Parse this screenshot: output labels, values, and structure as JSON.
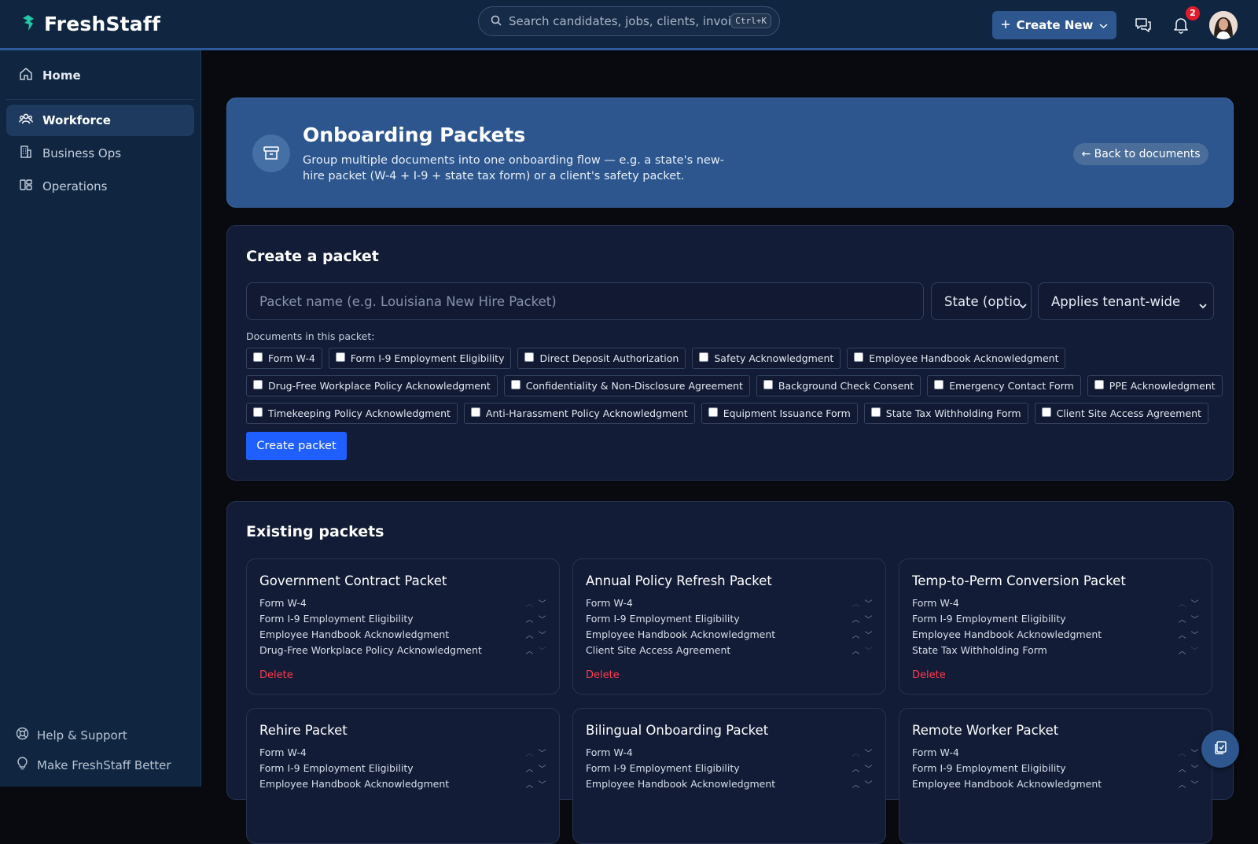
{
  "app": {
    "name": "FreshStaff"
  },
  "search": {
    "placeholder": "Search candidates, jobs, clients, invoices...",
    "shortcut": "Ctrl+K"
  },
  "header": {
    "create_new_label": "Create New",
    "notification_count": "2"
  },
  "sidebar": {
    "items": [
      {
        "label": "Home",
        "icon": "home-icon"
      },
      {
        "label": "Workforce",
        "icon": "users-icon",
        "active": true
      },
      {
        "label": "Business Ops",
        "icon": "building-icon"
      },
      {
        "label": "Operations",
        "icon": "grid-icon"
      }
    ],
    "footer": [
      {
        "label": "Help & Support",
        "icon": "lifebuoy-icon"
      },
      {
        "label": "Make FreshStaff Better",
        "icon": "lightbulb-icon"
      }
    ]
  },
  "hero": {
    "title": "Onboarding Packets",
    "description": "Group multiple documents into one onboarding flow — e.g. a state's new-hire packet (W-4 + I-9 + state tax form) or a client's safety packet.",
    "back_label": "← Back to documents"
  },
  "create": {
    "title": "Create a packet",
    "name_placeholder": "Packet name (e.g. Louisiana New Hire Packet)",
    "state_select": "State (optio",
    "scope_select": "Applies tenant-wide",
    "docs_label": "Documents in this packet:",
    "documents": [
      "Form W-4",
      "Form I-9 Employment Eligibility",
      "Direct Deposit Authorization",
      "Safety Acknowledgment",
      "Employee Handbook Acknowledgment",
      "Drug-Free Workplace Policy Acknowledgment",
      "Confidentiality & Non-Disclosure Agreement",
      "Background Check Consent",
      "Emergency Contact Form",
      "PPE Acknowledgment",
      "Timekeeping Policy Acknowledgment",
      "Anti-Harassment Policy Acknowledgment",
      "Equipment Issuance Form",
      "State Tax Withholding Form",
      "Client Site Access Agreement"
    ],
    "button_label": "Create packet"
  },
  "existing": {
    "title": "Existing packets",
    "delete_label": "Delete",
    "packets": [
      {
        "name": "Government Contract Packet",
        "docs": [
          "Form W-4",
          "Form I-9 Employment Eligibility",
          "Employee Handbook Acknowledgment",
          "Drug-Free Workplace Policy Acknowledgment"
        ]
      },
      {
        "name": "Annual Policy Refresh Packet",
        "docs": [
          "Form W-4",
          "Form I-9 Employment Eligibility",
          "Employee Handbook Acknowledgment",
          "Client Site Access Agreement"
        ]
      },
      {
        "name": "Temp-to-Perm Conversion Packet",
        "docs": [
          "Form W-4",
          "Form I-9 Employment Eligibility",
          "Employee Handbook Acknowledgment",
          "State Tax Withholding Form"
        ]
      },
      {
        "name": "Rehire Packet",
        "docs": [
          "Form W-4",
          "Form I-9 Employment Eligibility",
          "Employee Handbook Acknowledgment"
        ]
      },
      {
        "name": "Bilingual Onboarding Packet",
        "docs": [
          "Form W-4",
          "Form I-9 Employment Eligibility",
          "Employee Handbook Acknowledgment"
        ]
      },
      {
        "name": "Remote Worker Packet",
        "docs": [
          "Form W-4",
          "Form I-9 Employment Eligibility",
          "Employee Handbook Acknowledgment"
        ]
      }
    ]
  },
  "colors": {
    "accent": "#1f5fff",
    "danger": "#ff3b4e",
    "topbar": "#0f2540",
    "hero": "#2c568d",
    "logo": "#22c7a5"
  }
}
